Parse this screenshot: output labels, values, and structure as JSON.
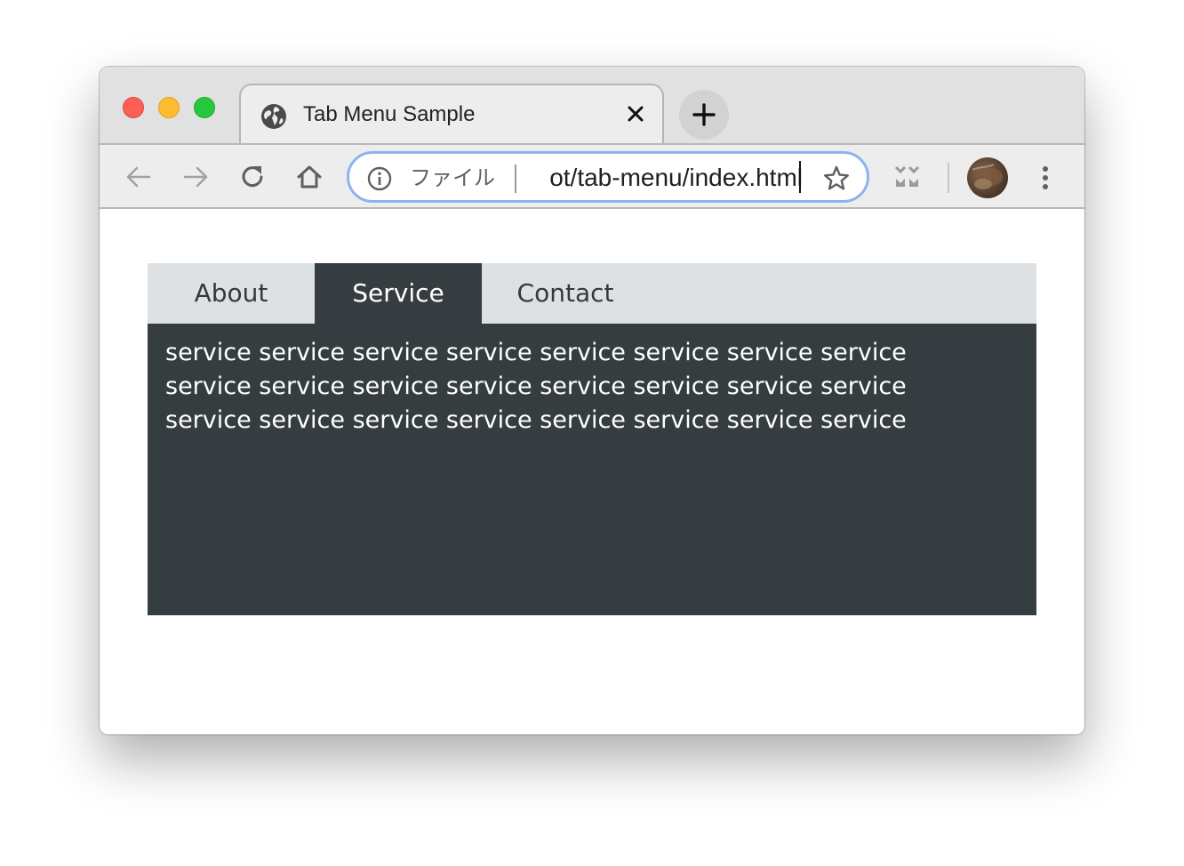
{
  "browser": {
    "tab": {
      "title": "Tab Menu Sample",
      "icon": "globe-icon",
      "close_icon": "close-icon"
    },
    "new_tab_icon": "plus-icon",
    "toolbar": {
      "back_icon": "back-arrow-icon",
      "forward_icon": "forward-arrow-icon",
      "reload_icon": "reload-icon",
      "home_icon": "home-icon",
      "extension_icon": "extension-icon",
      "menu_icon": "kebab-menu-icon"
    },
    "omnibox": {
      "info_icon": "info-icon",
      "scheme_label": "ファイル",
      "url_text": "ot/tab-menu/index.html",
      "star_icon": "star-icon",
      "focus_color": "#8ab4f0"
    }
  },
  "page": {
    "tabs": [
      {
        "label": "About",
        "active": false
      },
      {
        "label": "Service",
        "active": true
      },
      {
        "label": "Contact",
        "active": false
      }
    ],
    "panel_text": "service service service service service service service service service service service service service service service service service service service service service service service service",
    "colors": {
      "tab_bar_bg": "#dee1e3",
      "active_bg": "#363d40",
      "active_text": "#ffffff",
      "inactive_text": "#333a3c"
    }
  }
}
